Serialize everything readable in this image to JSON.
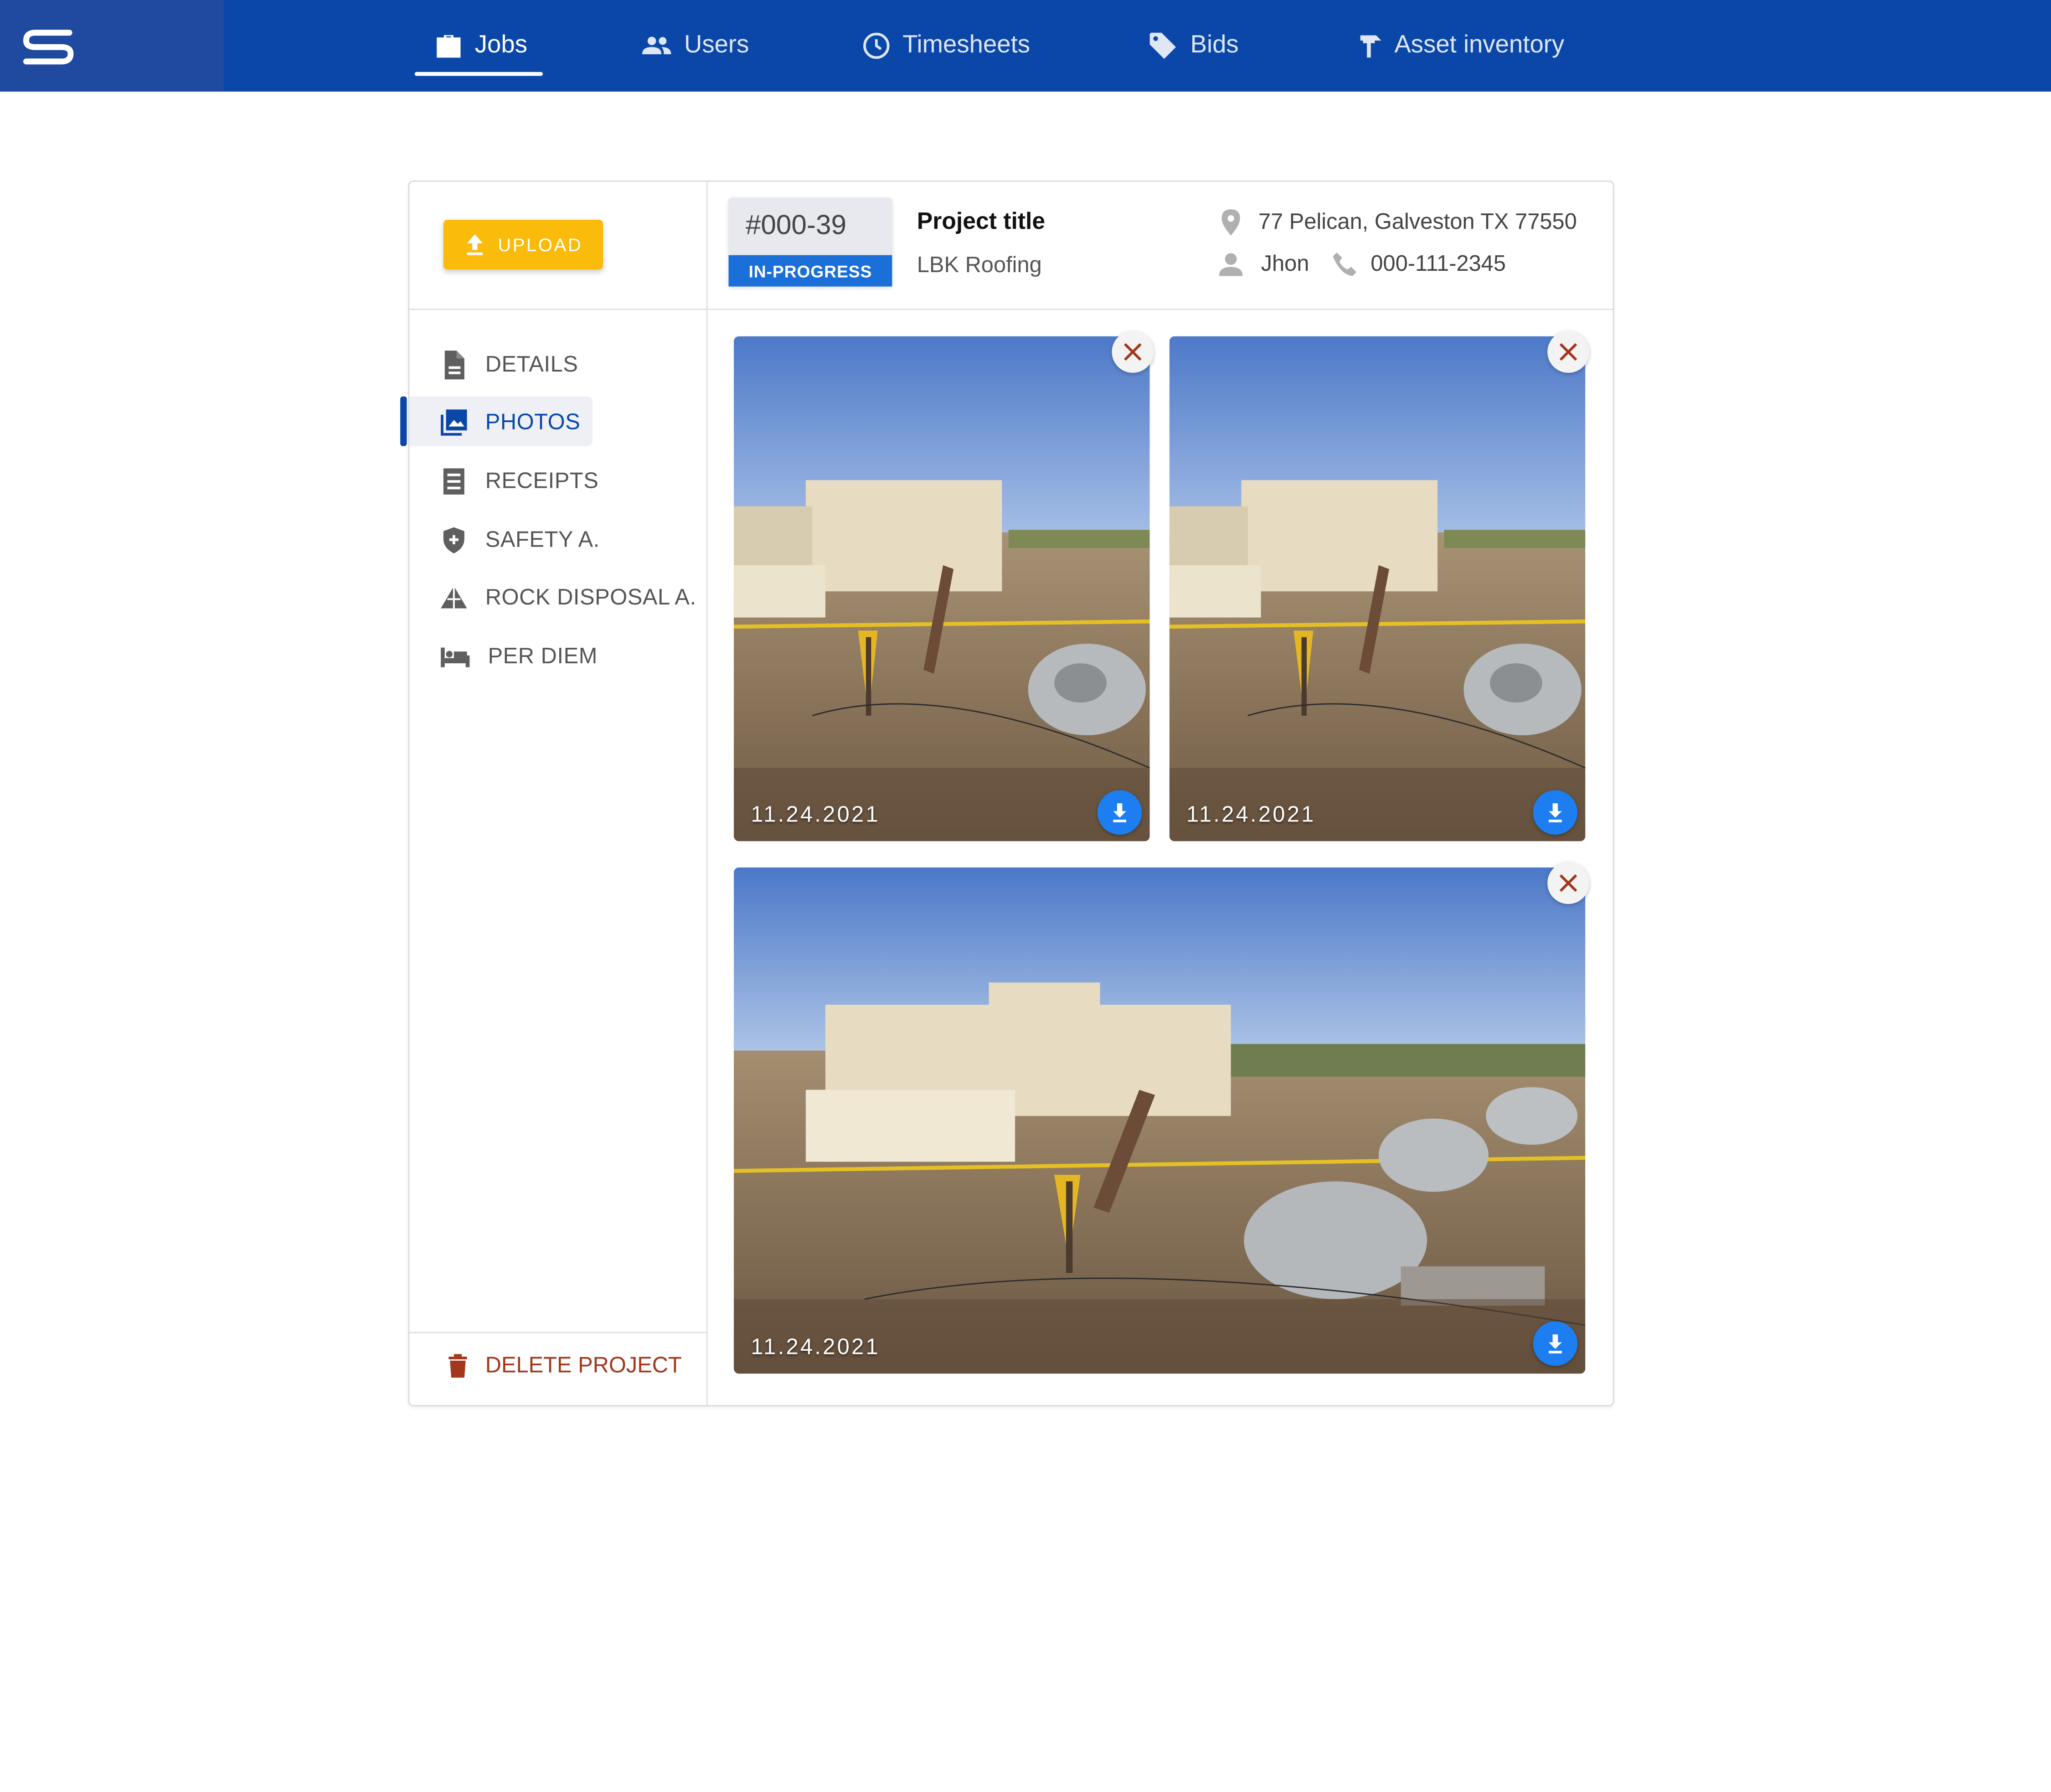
{
  "nav": {
    "items": [
      {
        "label": "Jobs",
        "icon": "briefcase-icon"
      },
      {
        "label": "Users",
        "icon": "users-icon"
      },
      {
        "label": "Timesheets",
        "icon": "clock-icon"
      },
      {
        "label": "Bids",
        "icon": "tag-icon"
      },
      {
        "label": "Asset inventory",
        "icon": "hammer-icon"
      }
    ],
    "active": "Jobs"
  },
  "header": {
    "upload_label": "UPLOAD",
    "job_id": "#000-39",
    "status": "IN-PROGRESS",
    "project_title": "Project title",
    "company": "LBK Roofing",
    "address": "77 Pelican, Galveston TX 77550",
    "contact_name": "Jhon",
    "phone": "000-111-2345"
  },
  "sidebar": {
    "items": [
      {
        "label": "DETAILS",
        "icon": "document-icon"
      },
      {
        "label": "PHOTOS",
        "icon": "photo-library-icon"
      },
      {
        "label": "RECEIPTS",
        "icon": "receipt-icon"
      },
      {
        "label": "SAFETY A.",
        "icon": "shield-icon"
      },
      {
        "label": "ROCK DISPOSAL A.",
        "icon": "rock-icon"
      },
      {
        "label": "PER DIEM",
        "icon": "bed-icon"
      }
    ],
    "active": "PHOTOS",
    "delete_label": "DELETE PROJECT"
  },
  "photos": [
    {
      "date": "11.24.2021"
    },
    {
      "date": "11.24.2021"
    },
    {
      "date": "11.24.2021"
    }
  ],
  "colors": {
    "nav_bg": "#0a47a9",
    "upload": "#fbbb0b",
    "status": "#1b6fd8",
    "delete": "#a3361b",
    "download": "#1c7ef0"
  }
}
